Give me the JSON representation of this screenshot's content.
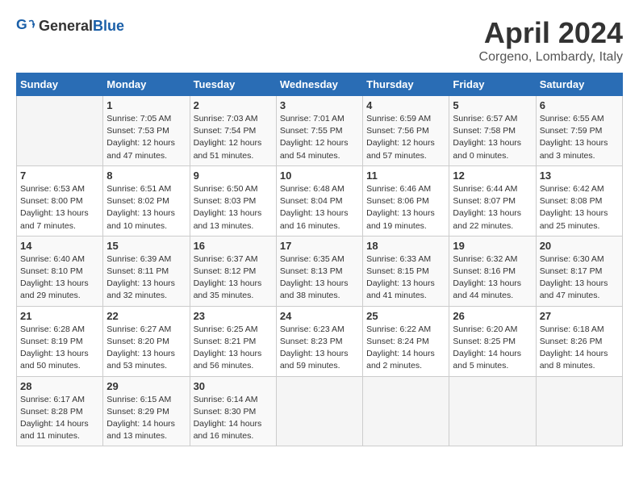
{
  "header": {
    "logo_general": "General",
    "logo_blue": "Blue",
    "month": "April 2024",
    "location": "Corgeno, Lombardy, Italy"
  },
  "days_of_week": [
    "Sunday",
    "Monday",
    "Tuesday",
    "Wednesday",
    "Thursday",
    "Friday",
    "Saturday"
  ],
  "weeks": [
    [
      {
        "day": "",
        "sunrise": "",
        "sunset": "",
        "daylight": ""
      },
      {
        "day": "1",
        "sunrise": "Sunrise: 7:05 AM",
        "sunset": "Sunset: 7:53 PM",
        "daylight": "Daylight: 12 hours and 47 minutes."
      },
      {
        "day": "2",
        "sunrise": "Sunrise: 7:03 AM",
        "sunset": "Sunset: 7:54 PM",
        "daylight": "Daylight: 12 hours and 51 minutes."
      },
      {
        "day": "3",
        "sunrise": "Sunrise: 7:01 AM",
        "sunset": "Sunset: 7:55 PM",
        "daylight": "Daylight: 12 hours and 54 minutes."
      },
      {
        "day": "4",
        "sunrise": "Sunrise: 6:59 AM",
        "sunset": "Sunset: 7:56 PM",
        "daylight": "Daylight: 12 hours and 57 minutes."
      },
      {
        "day": "5",
        "sunrise": "Sunrise: 6:57 AM",
        "sunset": "Sunset: 7:58 PM",
        "daylight": "Daylight: 13 hours and 0 minutes."
      },
      {
        "day": "6",
        "sunrise": "Sunrise: 6:55 AM",
        "sunset": "Sunset: 7:59 PM",
        "daylight": "Daylight: 13 hours and 3 minutes."
      }
    ],
    [
      {
        "day": "7",
        "sunrise": "Sunrise: 6:53 AM",
        "sunset": "Sunset: 8:00 PM",
        "daylight": "Daylight: 13 hours and 7 minutes."
      },
      {
        "day": "8",
        "sunrise": "Sunrise: 6:51 AM",
        "sunset": "Sunset: 8:02 PM",
        "daylight": "Daylight: 13 hours and 10 minutes."
      },
      {
        "day": "9",
        "sunrise": "Sunrise: 6:50 AM",
        "sunset": "Sunset: 8:03 PM",
        "daylight": "Daylight: 13 hours and 13 minutes."
      },
      {
        "day": "10",
        "sunrise": "Sunrise: 6:48 AM",
        "sunset": "Sunset: 8:04 PM",
        "daylight": "Daylight: 13 hours and 16 minutes."
      },
      {
        "day": "11",
        "sunrise": "Sunrise: 6:46 AM",
        "sunset": "Sunset: 8:06 PM",
        "daylight": "Daylight: 13 hours and 19 minutes."
      },
      {
        "day": "12",
        "sunrise": "Sunrise: 6:44 AM",
        "sunset": "Sunset: 8:07 PM",
        "daylight": "Daylight: 13 hours and 22 minutes."
      },
      {
        "day": "13",
        "sunrise": "Sunrise: 6:42 AM",
        "sunset": "Sunset: 8:08 PM",
        "daylight": "Daylight: 13 hours and 25 minutes."
      }
    ],
    [
      {
        "day": "14",
        "sunrise": "Sunrise: 6:40 AM",
        "sunset": "Sunset: 8:10 PM",
        "daylight": "Daylight: 13 hours and 29 minutes."
      },
      {
        "day": "15",
        "sunrise": "Sunrise: 6:39 AM",
        "sunset": "Sunset: 8:11 PM",
        "daylight": "Daylight: 13 hours and 32 minutes."
      },
      {
        "day": "16",
        "sunrise": "Sunrise: 6:37 AM",
        "sunset": "Sunset: 8:12 PM",
        "daylight": "Daylight: 13 hours and 35 minutes."
      },
      {
        "day": "17",
        "sunrise": "Sunrise: 6:35 AM",
        "sunset": "Sunset: 8:13 PM",
        "daylight": "Daylight: 13 hours and 38 minutes."
      },
      {
        "day": "18",
        "sunrise": "Sunrise: 6:33 AM",
        "sunset": "Sunset: 8:15 PM",
        "daylight": "Daylight: 13 hours and 41 minutes."
      },
      {
        "day": "19",
        "sunrise": "Sunrise: 6:32 AM",
        "sunset": "Sunset: 8:16 PM",
        "daylight": "Daylight: 13 hours and 44 minutes."
      },
      {
        "day": "20",
        "sunrise": "Sunrise: 6:30 AM",
        "sunset": "Sunset: 8:17 PM",
        "daylight": "Daylight: 13 hours and 47 minutes."
      }
    ],
    [
      {
        "day": "21",
        "sunrise": "Sunrise: 6:28 AM",
        "sunset": "Sunset: 8:19 PM",
        "daylight": "Daylight: 13 hours and 50 minutes."
      },
      {
        "day": "22",
        "sunrise": "Sunrise: 6:27 AM",
        "sunset": "Sunset: 8:20 PM",
        "daylight": "Daylight: 13 hours and 53 minutes."
      },
      {
        "day": "23",
        "sunrise": "Sunrise: 6:25 AM",
        "sunset": "Sunset: 8:21 PM",
        "daylight": "Daylight: 13 hours and 56 minutes."
      },
      {
        "day": "24",
        "sunrise": "Sunrise: 6:23 AM",
        "sunset": "Sunset: 8:23 PM",
        "daylight": "Daylight: 13 hours and 59 minutes."
      },
      {
        "day": "25",
        "sunrise": "Sunrise: 6:22 AM",
        "sunset": "Sunset: 8:24 PM",
        "daylight": "Daylight: 14 hours and 2 minutes."
      },
      {
        "day": "26",
        "sunrise": "Sunrise: 6:20 AM",
        "sunset": "Sunset: 8:25 PM",
        "daylight": "Daylight: 14 hours and 5 minutes."
      },
      {
        "day": "27",
        "sunrise": "Sunrise: 6:18 AM",
        "sunset": "Sunset: 8:26 PM",
        "daylight": "Daylight: 14 hours and 8 minutes."
      }
    ],
    [
      {
        "day": "28",
        "sunrise": "Sunrise: 6:17 AM",
        "sunset": "Sunset: 8:28 PM",
        "daylight": "Daylight: 14 hours and 11 minutes."
      },
      {
        "day": "29",
        "sunrise": "Sunrise: 6:15 AM",
        "sunset": "Sunset: 8:29 PM",
        "daylight": "Daylight: 14 hours and 13 minutes."
      },
      {
        "day": "30",
        "sunrise": "Sunrise: 6:14 AM",
        "sunset": "Sunset: 8:30 PM",
        "daylight": "Daylight: 14 hours and 16 minutes."
      },
      {
        "day": "",
        "sunrise": "",
        "sunset": "",
        "daylight": ""
      },
      {
        "day": "",
        "sunrise": "",
        "sunset": "",
        "daylight": ""
      },
      {
        "day": "",
        "sunrise": "",
        "sunset": "",
        "daylight": ""
      },
      {
        "day": "",
        "sunrise": "",
        "sunset": "",
        "daylight": ""
      }
    ]
  ]
}
